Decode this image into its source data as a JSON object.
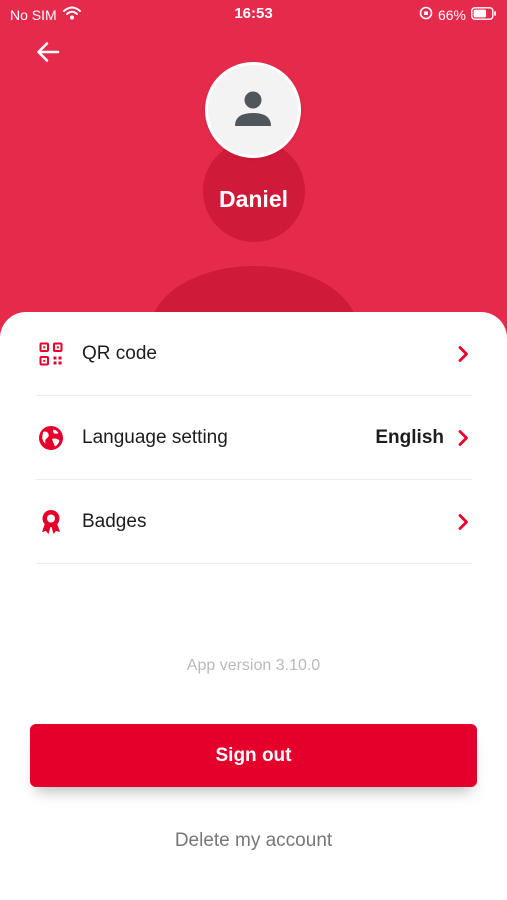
{
  "status_bar": {
    "carrier": "No SIM",
    "time": "16:53",
    "battery": "66%"
  },
  "header": {
    "back_icon": "arrow-left-icon",
    "avatar_icon": "person-icon",
    "username": "Daniel"
  },
  "menu": {
    "items": [
      {
        "icon": "qr-code-icon",
        "label": "QR code",
        "value": ""
      },
      {
        "icon": "globe-icon",
        "label": "Language setting",
        "value": "English"
      },
      {
        "icon": "badge-icon",
        "label": "Badges",
        "value": ""
      }
    ]
  },
  "footer": {
    "version": "App version 3.10.0",
    "signout_label": "Sign out",
    "delete_label": "Delete my account"
  },
  "colors": {
    "header_red": "#e52a4b",
    "accent_red": "#e4002b",
    "deco_red": "#cf1a39"
  }
}
